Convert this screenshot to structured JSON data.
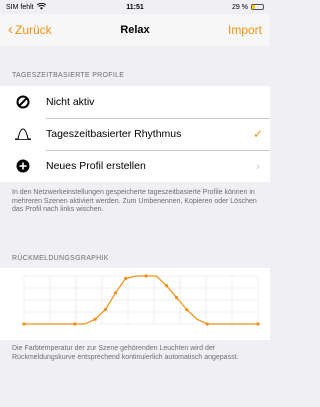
{
  "status": {
    "carrier": "SIM fehlt",
    "time": "11:51",
    "battery": "29 %",
    "battery_level": 0.29
  },
  "nav": {
    "back_label": "Zurück",
    "title": "Relax",
    "import_label": "Import"
  },
  "profiles": {
    "header": "TAGESZEITBASIERTE PROFILE",
    "items": [
      {
        "label": "Nicht aktiv",
        "icon": "disabled-icon"
      },
      {
        "label": "Tageszeitbasierter Rhythmus",
        "icon": "rhythm-curve-icon",
        "selected": true
      },
      {
        "label": "Neues Profil erstellen",
        "icon": "add-circle-icon"
      }
    ],
    "footnote": "In den Netzwerkeinstellungen gespeicherte tageszeitbasierte Profile können in mehreren Szenen aktiviert werden. Zum Umbenennen, Kopieren oder Löschen das Profil nach links wischen."
  },
  "feedback": {
    "header": "RÜCKMELDUNGSGRAPHIK",
    "footnote": "Die Farbtemperatur der zur Szene gehörenden Leuchten wird der Rückmeldungskurve entsprechend kontinuierlich automatisch angepasst."
  },
  "chart_data": {
    "type": "line",
    "x": [
      0,
      1,
      2,
      3,
      4,
      5,
      6,
      7,
      8,
      9,
      10,
      11,
      12,
      13,
      14,
      15,
      16,
      17,
      18,
      19,
      20,
      21,
      22,
      23
    ],
    "y": [
      0,
      0,
      0,
      0,
      0,
      0,
      0,
      0.1,
      0.3,
      0.65,
      0.95,
      1,
      1,
      1,
      0.8,
      0.55,
      0.3,
      0.1,
      0,
      0,
      0,
      0,
      0,
      0
    ],
    "markers_at": [
      0,
      5,
      7,
      8,
      9,
      10,
      12,
      14,
      15,
      16,
      18,
      23
    ],
    "color": "#f09010",
    "grid": true,
    "ylim": [
      0,
      1
    ]
  },
  "colors": {
    "accent": "#f09010",
    "background": "#efeff4"
  }
}
